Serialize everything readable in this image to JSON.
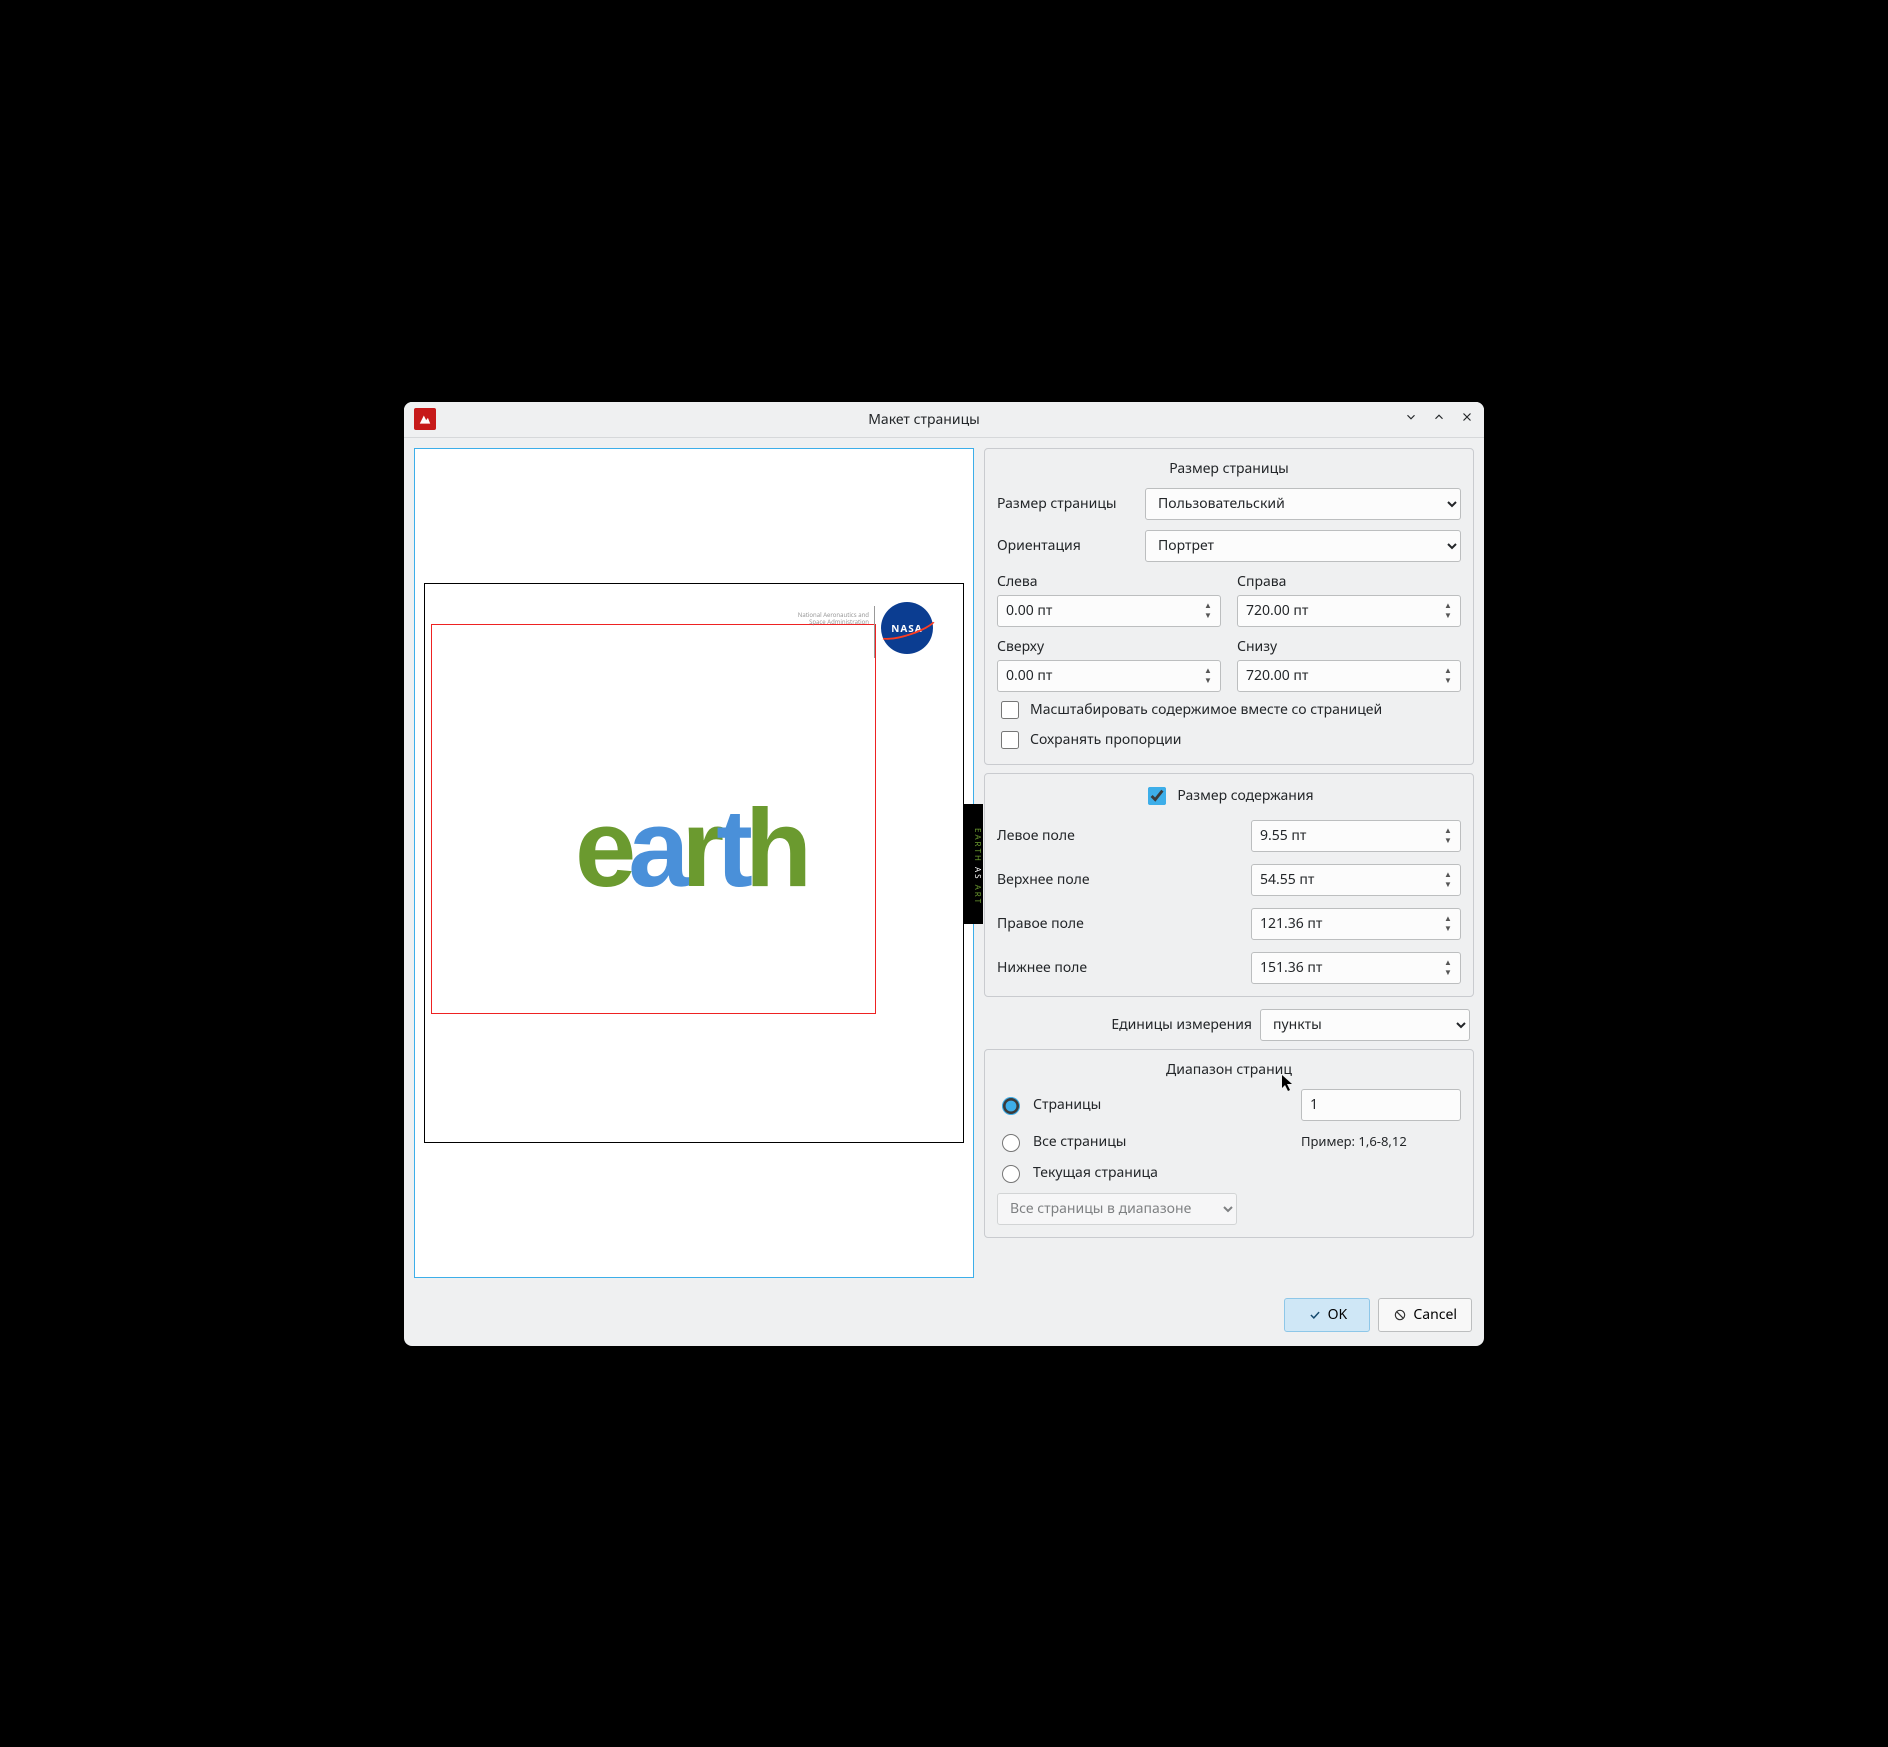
{
  "window": {
    "title": "Макет страницы"
  },
  "pageSize": {
    "groupTitle": "Размер страницы",
    "sizeLabel": "Размер страницы",
    "sizeValue": "Пользовательский",
    "orientLabel": "Ориентация",
    "orientValue": "Портрет",
    "leftLabel": "Слева",
    "leftValue": "0.00 пт",
    "rightLabel": "Справа",
    "rightValue": "720.00 пт",
    "topLabel": "Сверху",
    "topValue": "0.00 пт",
    "bottomLabel": "Снизу",
    "bottomValue": "720.00 пт",
    "scaleLabel": "Масштабировать содержимое вместе со страницей",
    "keepRatioLabel": "Сохранять пропорции"
  },
  "contentSize": {
    "checkboxLabel": "Размер содержания",
    "leftMarginLabel": "Левое поле",
    "leftMarginValue": "9.55 пт",
    "topMarginLabel": "Верхнее поле",
    "topMarginValue": "54.55 пт",
    "rightMarginLabel": "Правое поле",
    "rightMarginValue": "121.36 пт",
    "bottomMarginLabel": "Нижнее поле",
    "bottomMarginValue": "151.36 пт"
  },
  "units": {
    "label": "Единицы измерения",
    "value": "пункты"
  },
  "pageRange": {
    "groupTitle": "Диапазон страниц",
    "pagesLabel": "Страницы",
    "pagesValue": "1",
    "allPagesLabel": "Все страницы",
    "exampleLabel": "Пример: 1,6-8,12",
    "currentPageLabel": "Текущая страница",
    "rangeModeValue": "Все страницы в диапазоне"
  },
  "footer": {
    "ok": "OK",
    "cancel": "Cancel"
  },
  "preview": {
    "nasaText": "NASA",
    "nasaCaption1": "National Aeronautics and",
    "nasaCaption2": "Space Administration",
    "sideTabText1": "EARTH",
    "sideTabText2": "ART"
  }
}
